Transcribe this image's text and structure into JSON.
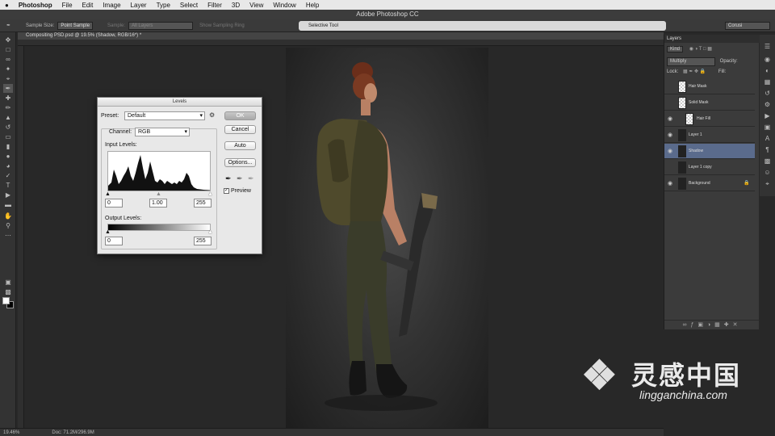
{
  "menubar": {
    "apple": "",
    "items": [
      "Photoshop",
      "File",
      "Edit",
      "Image",
      "Layer",
      "Type",
      "Select",
      "Filter",
      "3D",
      "View",
      "Window",
      "Help"
    ]
  },
  "window_title": "Adobe Photoshop CC",
  "options_bar": {
    "sample_size_label": "Sample Size:",
    "sample_size_value": "Point Sample",
    "sample_label": "Sample:",
    "sample_value": "All Layers",
    "show_ring": "Show Sampling Ring",
    "search_text": "Selective Tool",
    "workspace": "Corusi"
  },
  "document_tab": "Compositing PSD.psd @ 19.5% (Shadow, RGB/16*) *",
  "status": {
    "zoom": "19.46%",
    "doc": "Doc: 71.2M/296.9M"
  },
  "layers_panel": {
    "tab": "Layers",
    "kind": "Kind",
    "blend": "Multiply",
    "opacity_label": "Opacity:",
    "lock_label": "Lock:",
    "fill_label": "Fill:",
    "layers": [
      {
        "name": "Hair Mask",
        "visible": false,
        "selected": false
      },
      {
        "name": "Solid Mask",
        "visible": false,
        "selected": false
      },
      {
        "name": "Hair Fill",
        "visible": true,
        "selected": false
      },
      {
        "name": "Layer 1",
        "visible": true,
        "selected": false
      },
      {
        "name": "Shadow",
        "visible": true,
        "selected": true
      },
      {
        "name": "Layer 1 copy",
        "visible": false,
        "selected": false
      },
      {
        "name": "Background",
        "visible": true,
        "selected": false
      }
    ]
  },
  "levels": {
    "title": "Levels",
    "preset_label": "Preset:",
    "preset_value": "Default",
    "channel_label": "Channel:",
    "channel_value": "RGB",
    "input_label": "Input Levels:",
    "output_label": "Output Levels:",
    "input_black": "0",
    "input_gamma": "1.00",
    "input_white": "255",
    "output_black": "0",
    "output_white": "255",
    "ok": "OK",
    "cancel": "Cancel",
    "auto": "Auto",
    "options": "Options...",
    "preview": "Preview",
    "preview_checked": true
  },
  "watermark": {
    "cn": "灵感中国",
    "url": "lingganchina.com"
  }
}
